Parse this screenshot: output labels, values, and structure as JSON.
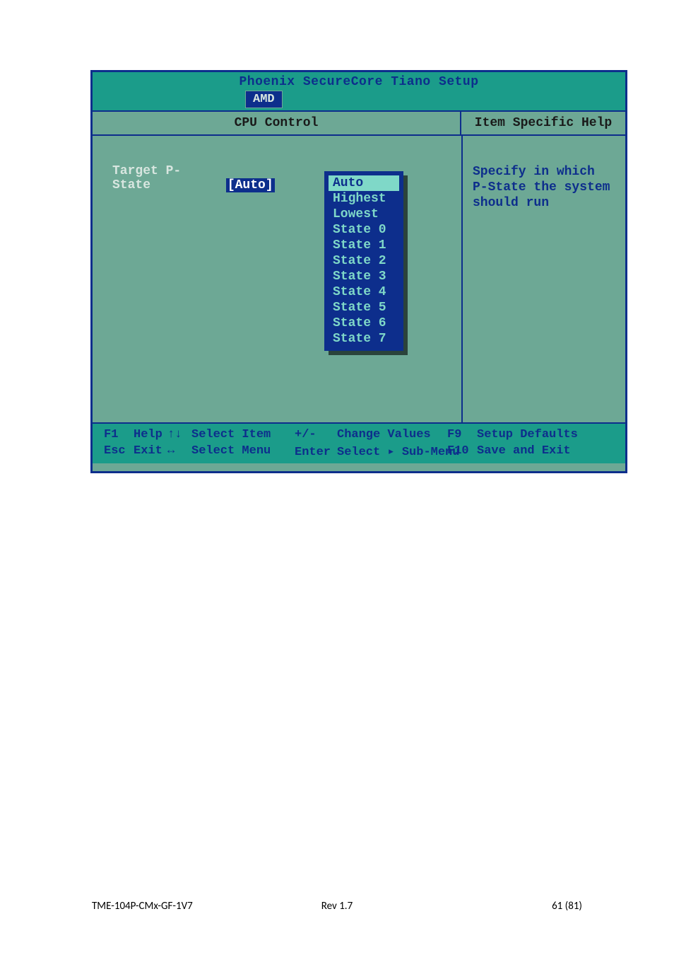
{
  "bios": {
    "title": "Phoenix SecureCore Tiano Setup",
    "tab": "AMD",
    "panel_title": "CPU Control",
    "help_title": "Item Specific Help",
    "setting": {
      "label": "Target P-State",
      "current": "[Auto]"
    },
    "popup": {
      "selected": "Auto",
      "options": [
        "Auto",
        "Highest",
        "Lowest",
        "State 0",
        "State 1",
        "State 2",
        "State 3",
        "State 4",
        "State 5",
        "State 6",
        "State 7"
      ]
    },
    "help_text": [
      "Specify in which",
      "P-State the system",
      "should run"
    ],
    "footer": {
      "f1": {
        "key": "F1",
        "label": "Help"
      },
      "esc": {
        "key": "Esc",
        "label": "Exit"
      },
      "updown": {
        "key": "↑↓",
        "label": "Select Item"
      },
      "leftright": {
        "key": "↔",
        "label": "Select Menu"
      },
      "plusminus": {
        "key": "+/-",
        "label": "Change Values"
      },
      "enter": {
        "key": "Enter",
        "label": "Select ▸ Sub-Menu"
      },
      "f9": {
        "key": "F9",
        "label": "Setup Defaults"
      },
      "f10": {
        "key": "F10",
        "label": "Save and Exit"
      }
    }
  },
  "page_footer": {
    "left": "TME-104P-CMx-GF-1V7",
    "center": "Rev 1.7",
    "right": "61 (81)"
  }
}
